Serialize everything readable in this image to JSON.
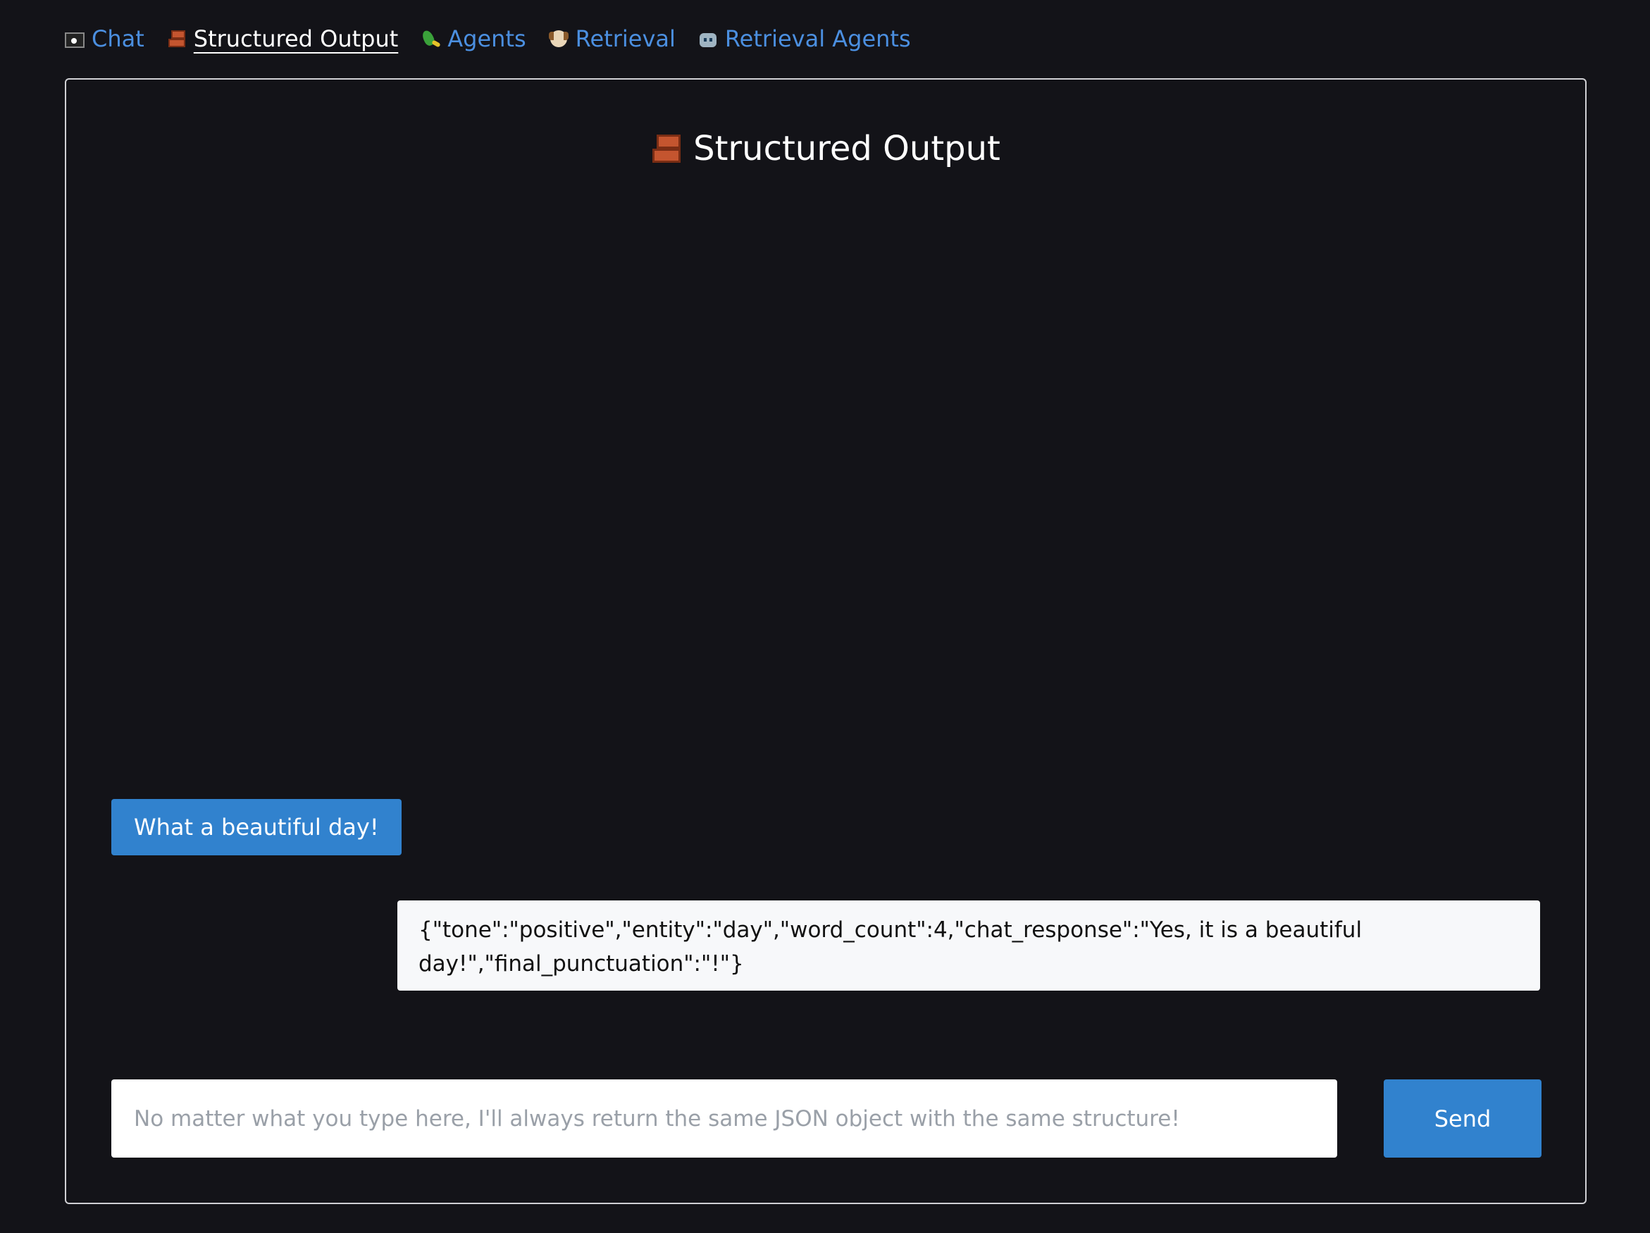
{
  "nav": {
    "items": [
      {
        "icon": "pirate-flag-icon",
        "label": "Chat",
        "active": false
      },
      {
        "icon": "bricks-icon",
        "label": "Structured Output",
        "active": true
      },
      {
        "icon": "parrot-icon",
        "label": "Agents",
        "active": false
      },
      {
        "icon": "dog-icon",
        "label": "Retrieval",
        "active": false
      },
      {
        "icon": "robot-icon",
        "label": "Retrieval Agents",
        "active": false
      }
    ]
  },
  "page": {
    "title_icon": "bricks-icon",
    "title": "Structured Output"
  },
  "messages": [
    {
      "role": "user",
      "text": "What a beautiful day!"
    },
    {
      "role": "assistant",
      "text": "{\"tone\":\"positive\",\"entity\":\"day\",\"word_count\":4,\"chat_response\":\"Yes, it is a beautiful day!\",\"final_punctuation\":\"!\"}"
    }
  ],
  "composer": {
    "value": "",
    "placeholder": "No matter what you type here, I'll always return the same JSON object with the same structure!",
    "send_label": "Send"
  },
  "colors": {
    "background": "#131318",
    "link": "#4b8fe0",
    "accent": "#3182ce",
    "assistant_bubble": "#f7f8fa"
  }
}
